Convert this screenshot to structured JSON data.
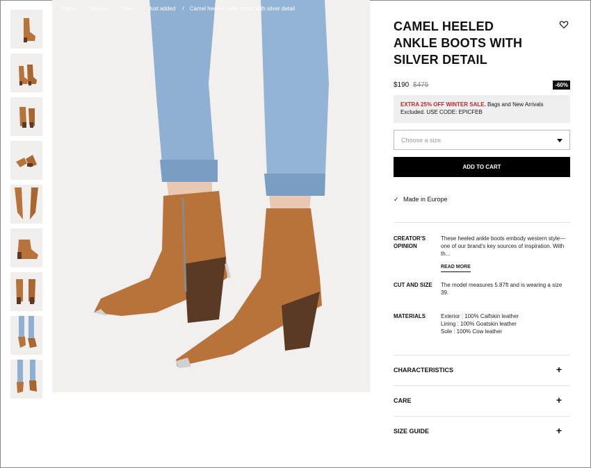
{
  "breadcrumb": [
    "Home",
    "Woman",
    "Sale",
    "Just added",
    "Camel heeled ankle boots with silver detail"
  ],
  "product": {
    "title": "CAMEL HEELED ANKLE BOOTS WITH SILVER DETAIL",
    "price": "$190",
    "old_price": "$475",
    "discount_badge": "-60%",
    "promo_highlight": "EXTRA 25% OFF WINTER SALE.",
    "promo_text": " Bags and New Arrivals Excluded. USE CODE: EPICFEB",
    "size_placeholder": "Choose a size",
    "add_to_cart": "ADD TO CART",
    "origin": "Made in Europe"
  },
  "specs": {
    "creator_key": "CREATOR'S OPINION",
    "creator_val": "These heeled ankle boots embody western style—one of our brand's key sources of inspiration. With th...",
    "read_more": "READ MORE",
    "cut_key": "CUT AND SIZE",
    "cut_val": "The model measures 5.87ft and is wearing a size 39.",
    "materials_key": "MATERIALS",
    "materials_lines": [
      "Exterior : 100% Calfskin leather",
      "Lining : 100% Goatskin leather",
      "Sole : 100% Cow leather"
    ]
  },
  "accordions": [
    "CHARACTERISTICS",
    "CARE",
    "SIZE GUIDE"
  ],
  "icons": {
    "wishlist": "heart-icon",
    "check": "check-icon",
    "expand": "plus-icon",
    "dropdown": "caret-down-icon"
  },
  "colors": {
    "accent_red": "#c0272d",
    "camel": "#b8733a",
    "denim": "#8fb0d3"
  }
}
